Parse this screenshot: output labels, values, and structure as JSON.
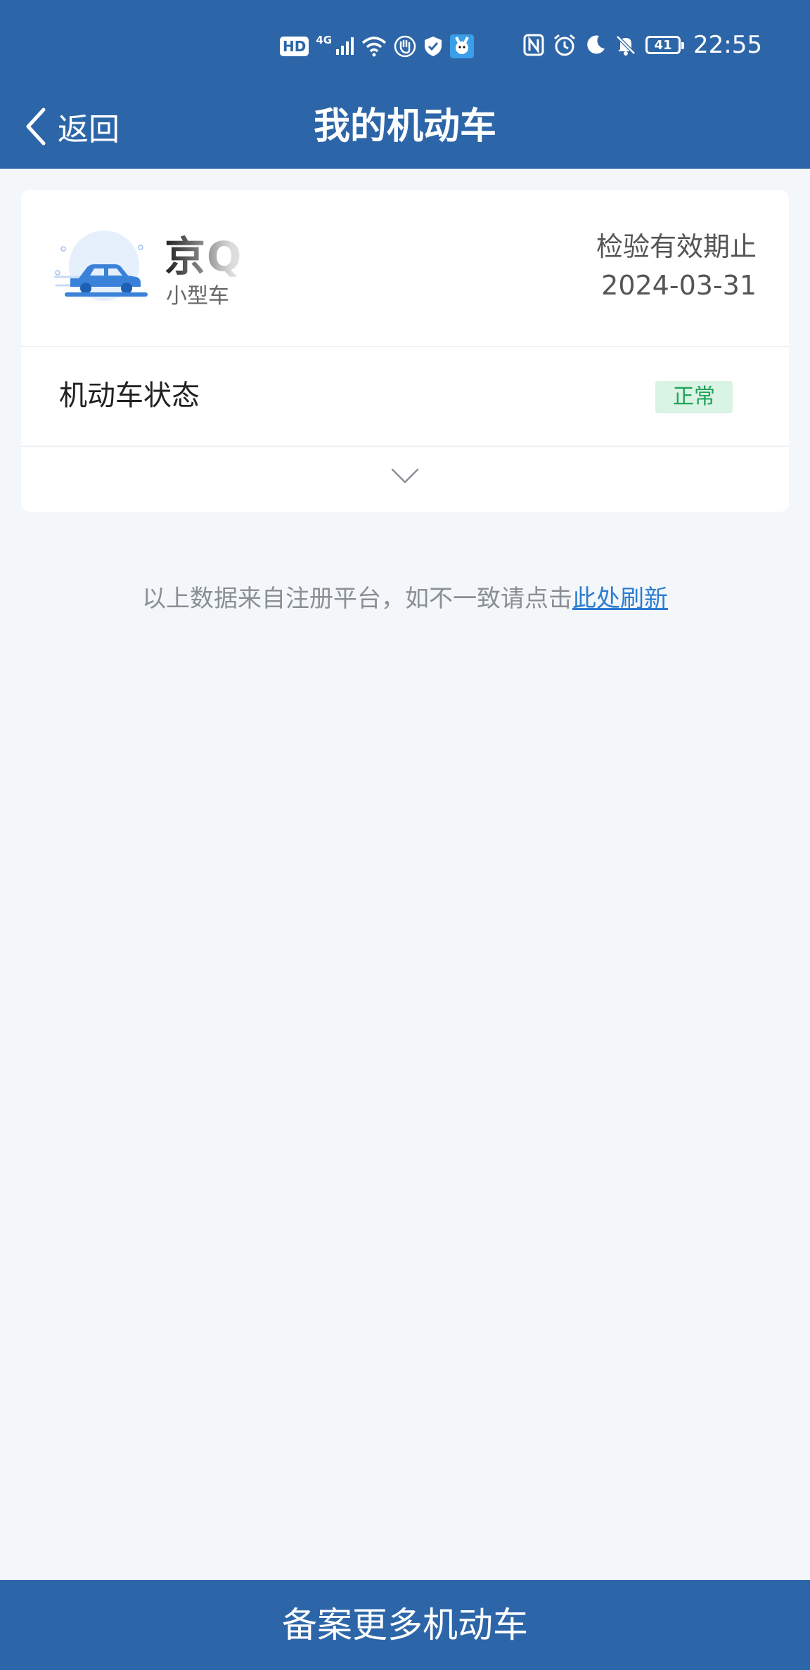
{
  "status_bar": {
    "hd_label": "HD",
    "network_label": "4G",
    "battery_level": "41",
    "time": "22:55",
    "icons_left": [
      "hd-icon",
      "signal-icon",
      "wifi-icon",
      "hand-icon",
      "shield-icon",
      "app-icon"
    ],
    "icons_right": [
      "nfc-icon",
      "alarm-icon",
      "moon-icon",
      "mute-icon",
      "battery-icon"
    ]
  },
  "nav": {
    "back_label": "返回",
    "title": "我的机动车"
  },
  "vehicle": {
    "plate": "京Q",
    "type": "小型车",
    "expiry_label": "检验有效期止",
    "expiry_date": "2024-03-31"
  },
  "status": {
    "label": "机动车状态",
    "value": "正常"
  },
  "note": {
    "text": "以上数据来自注册平台，如不一致请点击",
    "link": "此处刷新"
  },
  "bottom_button": {
    "label": "备案更多机动车"
  },
  "colors": {
    "primary": "#2d66a8",
    "background": "#f4f7f9",
    "status_bg": "#d9f3e4",
    "status_text": "#22a35a",
    "link": "#2c7cd0"
  }
}
